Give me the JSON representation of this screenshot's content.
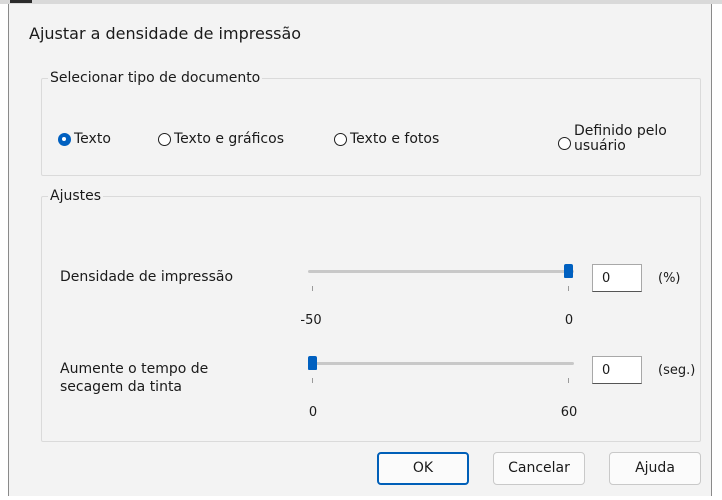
{
  "window": {
    "title": "Ajustar a densidade de impressão"
  },
  "document_type": {
    "legend": "Selecionar tipo de documento",
    "options": [
      {
        "label": "Texto",
        "selected": true
      },
      {
        "label": "Texto e gráficos",
        "selected": false
      },
      {
        "label": "Texto e fotos",
        "selected": false
      },
      {
        "label": "Definido pelo usuário",
        "selected": false
      }
    ]
  },
  "adjustments": {
    "legend": "Ajustes",
    "density": {
      "label": "Densidade de impressão",
      "min_label": "-50",
      "max_label": "0",
      "value": "0",
      "unit": "(%)",
      "slider_fraction": 1.0
    },
    "drying": {
      "label": "Aumente o tempo de secagem da tinta",
      "min_label": "0",
      "max_label": "60",
      "value": "0",
      "unit": "(seg.)",
      "slider_fraction": 0.0
    }
  },
  "buttons": {
    "ok": "OK",
    "cancel": "Cancelar",
    "help": "Ajuda"
  },
  "colors": {
    "accent": "#0060c0",
    "dialog_bg": "#f3f3f3"
  }
}
